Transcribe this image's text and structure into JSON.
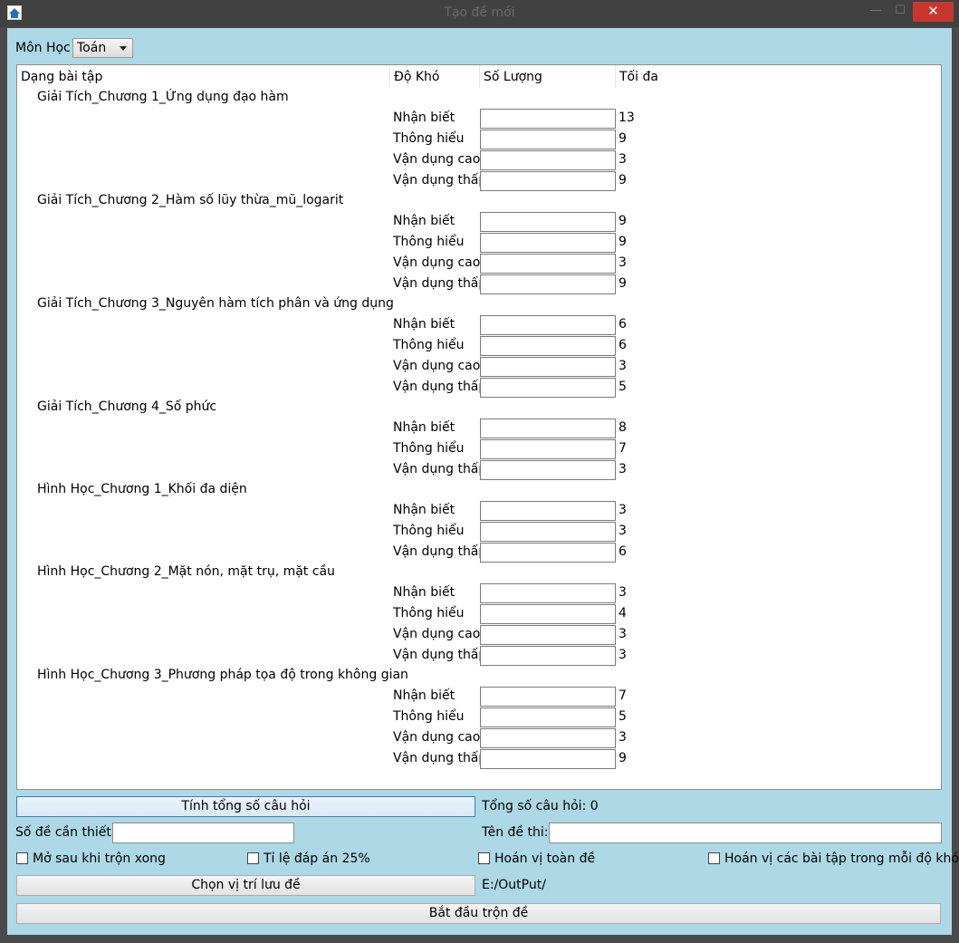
{
  "window": {
    "title": "Tạo đề mới",
    "minimize": "—",
    "maximize": "☐",
    "close": "✕"
  },
  "subject": {
    "label": "Môn Học",
    "selected": "Toán"
  },
  "table": {
    "headers": [
      "Dạng bài tập",
      "Độ Khó",
      "Số Lượng",
      "Tối đa"
    ],
    "chapters": [
      {
        "name": "Giải Tích_Chương 1_Ứng dụng đạo hàm",
        "rows": [
          {
            "level": "Nhận biết",
            "max": "13"
          },
          {
            "level": "Thông hiểu",
            "max": "9"
          },
          {
            "level": "Vận dụng cao",
            "max": "3"
          },
          {
            "level": "Vận dụng thấp",
            "max": "9"
          }
        ]
      },
      {
        "name": "Giải Tích_Chương 2_Hàm số lũy thừa_mũ_logarit",
        "rows": [
          {
            "level": "Nhận biết",
            "max": "9"
          },
          {
            "level": "Thông hiểu",
            "max": "9"
          },
          {
            "level": "Vận dụng cao",
            "max": "3"
          },
          {
            "level": "Vận dụng thấp",
            "max": "9"
          }
        ]
      },
      {
        "name": "Giải Tích_Chương 3_Nguyên hàm tích phân và ứng dụng",
        "rows": [
          {
            "level": "Nhận biết",
            "max": "6"
          },
          {
            "level": "Thông hiểu",
            "max": "6"
          },
          {
            "level": "Vận dụng cao",
            "max": "3"
          },
          {
            "level": "Vận dụng thấp",
            "max": "5"
          }
        ]
      },
      {
        "name": "Giải Tích_Chương 4_Số phức",
        "rows": [
          {
            "level": "Nhận biết",
            "max": "8"
          },
          {
            "level": "Thông hiểu",
            "max": "7"
          },
          {
            "level": "Vận dụng thấp",
            "max": "3"
          }
        ]
      },
      {
        "name": "Hình Học_Chương 1_Khối đa diện",
        "rows": [
          {
            "level": "Nhận biết",
            "max": "3"
          },
          {
            "level": "Thông hiểu",
            "max": "3"
          },
          {
            "level": "Vận dụng thấp",
            "max": "6"
          }
        ]
      },
      {
        "name": "Hình Học_Chương 2_Mặt nón, mặt trụ, mặt cầu",
        "rows": [
          {
            "level": "Nhận biết",
            "max": "3"
          },
          {
            "level": "Thông hiểu",
            "max": "4"
          },
          {
            "level": "Vận dụng cao",
            "max": "3"
          },
          {
            "level": "Vận dụng thấp",
            "max": "3"
          }
        ]
      },
      {
        "name": "Hình Học_Chương 3_Phương pháp tọa độ trong không gian",
        "rows": [
          {
            "level": "Nhận biết",
            "max": "7"
          },
          {
            "level": "Thông hiểu",
            "max": "5"
          },
          {
            "level": "Vận dụng cao",
            "max": "3"
          },
          {
            "level": "Vận dụng thấp",
            "max": "9"
          }
        ]
      }
    ]
  },
  "actions": {
    "compute_label": "Tính tổng số câu hỏi",
    "total_text": "Tổng số câu hỏi: 0",
    "num_exams_label": "Số đề cần thiết:",
    "num_exams_value": "",
    "exam_name_label": "Tên đề thi:",
    "exam_name_value": "",
    "choose_path_label": "Chọn vị trí lưu đề",
    "output_path": "E:/OutPut/",
    "start_label": "Bắt đầu trộn đề"
  },
  "options": [
    {
      "label": "Mở sau khi trộn xong",
      "checked": false
    },
    {
      "label": "Tỉ lệ đáp án 25%",
      "checked": false
    },
    {
      "label": "Hoán vị toàn đề",
      "checked": false
    },
    {
      "label": "Hoán vị các bài tập trong mỗi độ khó",
      "checked": false
    }
  ],
  "colors": {
    "client_bg": "#add8e6",
    "close_button": "#c7372f"
  }
}
